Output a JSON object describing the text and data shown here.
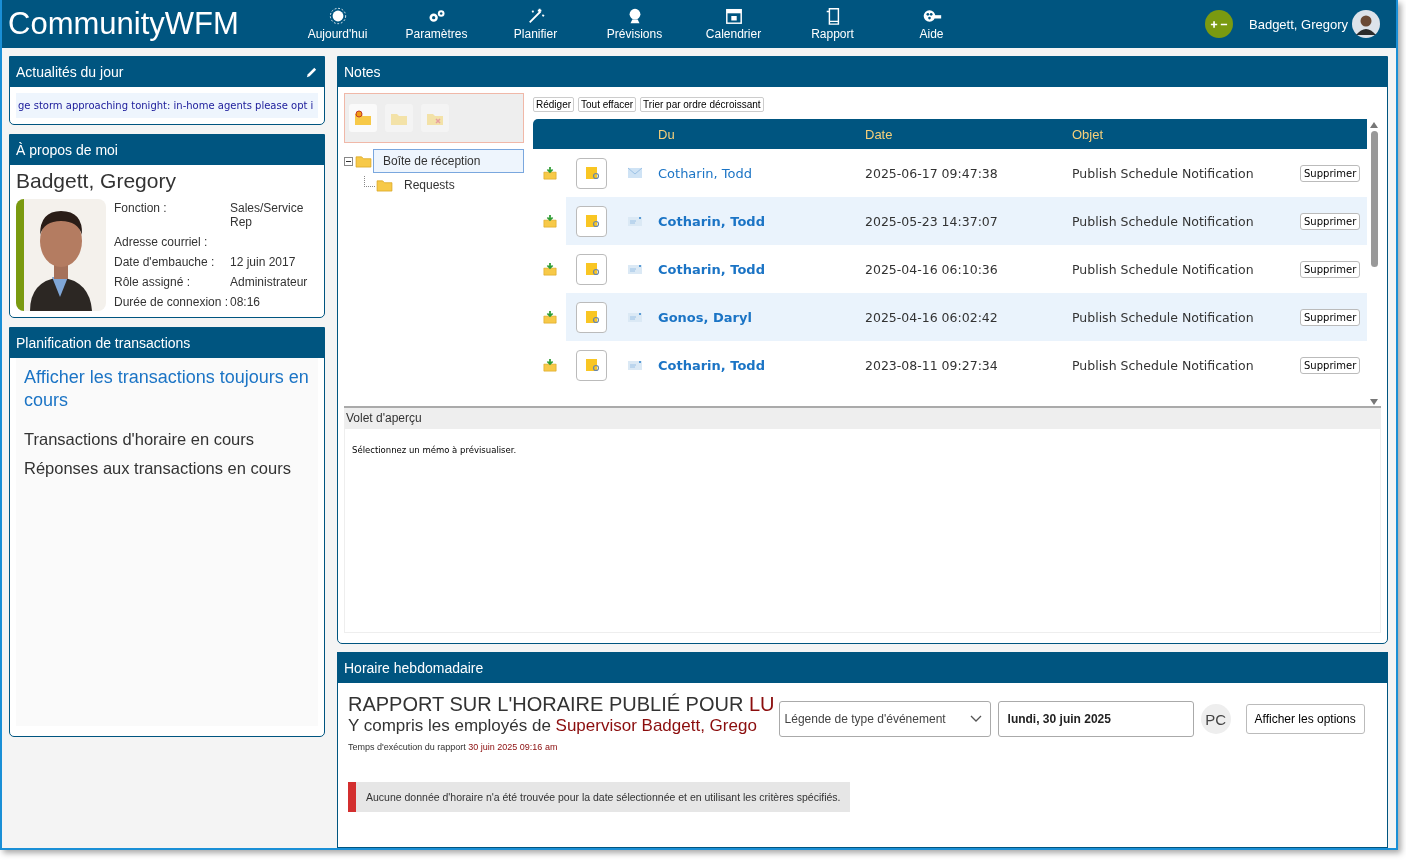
{
  "app": {
    "title": "CommunityWFM",
    "user": "Badgett, Gregory"
  },
  "nav": [
    {
      "label": "Aujourd'hui",
      "kind": "sun"
    },
    {
      "label": "Paramètres",
      "kind": "gears"
    },
    {
      "label": "Planifier",
      "kind": "wand"
    },
    {
      "label": "Prévisions",
      "kind": "crystal"
    },
    {
      "label": "Calendrier",
      "kind": "calendar"
    },
    {
      "label": "Rapport",
      "kind": "pages"
    },
    {
      "label": "Aide",
      "kind": "film"
    }
  ],
  "news": {
    "title": "Actualités du jour",
    "ticker": "ge storm approaching tonight: in-home agents please opt i"
  },
  "about": {
    "title": "À propos de moi",
    "name": "Badgett, Gregory",
    "fields": [
      {
        "label": "Fonction :",
        "value": "Sales/Service Rep"
      },
      {
        "label": "Adresse courriel :"
      },
      {
        "label": "Date d'embauche :",
        "value": "12 juin 2017"
      },
      {
        "label": "Rôle assigné :",
        "value": "Administrateur"
      },
      {
        "label": "Durée de connexion :",
        "value": "08:16"
      }
    ]
  },
  "transactions": {
    "title": "Planification de transactions",
    "link": "Afficher les transactions toujours en cours",
    "items": [
      "Transactions d'horaire en cours",
      "Réponses aux transactions en cours"
    ]
  },
  "notes": {
    "title": "Notes",
    "actions": [
      "Rédiger",
      "Tout effacer",
      "Trier par ordre décroissant"
    ],
    "folders": [
      {
        "label": "Boîte de réception",
        "selected": true,
        "expanded": true,
        "children": [
          {
            "label": "Requests",
            "selected": false
          }
        ]
      }
    ],
    "columns": [
      "Du",
      "Date",
      "Objet"
    ],
    "rows": [
      {
        "from": "Cotharin, Todd",
        "date": "2025-06-17 09:47:38",
        "subject": "Publish Schedule Notification",
        "read": true,
        "action": "Supprimer"
      },
      {
        "from": "Cotharin, Todd",
        "date": "2025-05-23 14:37:07",
        "subject": "Publish Schedule Notification",
        "read": false,
        "action": "Supprimer"
      },
      {
        "from": "Cotharin, Todd",
        "date": "2025-04-16 06:10:36",
        "subject": "Publish Schedule Notification",
        "read": false,
        "action": "Supprimer"
      },
      {
        "from": "Gonos, Daryl",
        "date": "2025-04-16 06:02:42",
        "subject": "Publish Schedule Notification",
        "read": false,
        "action": "Supprimer"
      },
      {
        "from": "Cotharin, Todd",
        "date": "2023-08-11 09:27:34",
        "subject": "Publish Schedule Notification",
        "read": false,
        "action": "Supprimer"
      }
    ],
    "preview_title": "Volet d'aperçu",
    "preview_text": "Sélectionnez un mémo à prévisualiser."
  },
  "schedule": {
    "title": "Horaire hebdomadaire",
    "heading": "RAPPORT SUR L'HORAIRE PUBLIÉ POUR ",
    "heading_highlight": "LU",
    "subheading": "Y compris les employés de ",
    "subheading_highlight": "Supervisor Badgett, Grego",
    "runtime_label": "Temps d'exécution du rapport",
    "runtime_value": "30 juin 2025 09:16 am",
    "legend_placeholder": "Légende de type d'événement",
    "date_value": "lundi, 30 juin 2025",
    "pc_label": "PC",
    "options_button": "Afficher les options",
    "message": "Aucune donnée d'horaire n'a été trouvée pour la date sélectionnée et en utilisant les critères spécifiés."
  }
}
